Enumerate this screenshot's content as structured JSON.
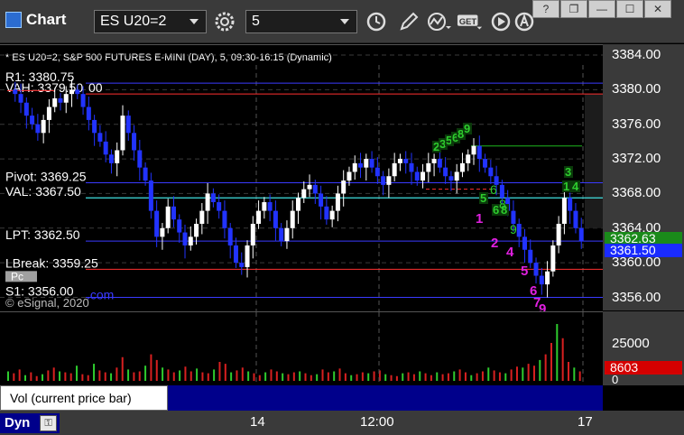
{
  "toolbar": {
    "title": "Chart",
    "symbol": "ES U20=2",
    "interval": "5",
    "get_label": "GET"
  },
  "window_buttons": [
    "?",
    "❐",
    "—",
    "☐",
    "✕"
  ],
  "chart": {
    "header": "* ES U20=2, S&P 500 FUTURES E-MINI (DAY), 5, 09:30-16:15 (Dynamic)",
    "watermark": "© eSignal, 2020",
    "levels": [
      {
        "label": "R1: 3380.75",
        "price": 3380.75,
        "color": "#3a3aff"
      },
      {
        "label": "VAH: 3379.50",
        "price": 3379.5,
        "color": "#ff3030"
      },
      {
        "label": "Pivot: 3369.25",
        "price": 3369.25,
        "color": "#3a3aff"
      },
      {
        "label": "VAL: 3367.50",
        "price": 3367.5,
        "color": "#40e0e0"
      },
      {
        "label": "LPT: 3362.50",
        "price": 3362.5,
        "color": "#3a3aff"
      },
      {
        "label": "LBreak: 3359.25",
        "price": 3359.25,
        "color": "#ff3030"
      },
      {
        "label": "S1: 3356.00",
        "price": 3356.0,
        "color": "#3a3aff"
      }
    ],
    "extra_labels": {
      "vah_overlap": "00",
      "pc_tag": "Pc",
      "com_tag": ".com"
    },
    "seq_numbers_magenta": [
      "1",
      "2",
      "4",
      "5",
      "6",
      "7",
      "9"
    ],
    "seq_numbers_green": [
      "2",
      "3",
      "5",
      "6",
      "8",
      "9",
      "3",
      "1",
      "4",
      "5",
      "6",
      "8"
    ]
  },
  "price_axis": {
    "ticks": [
      "3384.00",
      "3380.00",
      "3376.00",
      "3372.00",
      "3368.00",
      "3364.00",
      "3360.00",
      "3356.00"
    ],
    "badge_green": "3362.63",
    "badge_blue": "3361.50"
  },
  "volume": {
    "legend": "Vol (current price bar)",
    "close_glyph": "×",
    "ticks": [
      "25000",
      "0"
    ],
    "badge_red": "8603"
  },
  "time_axis": {
    "ticks": [
      "14",
      "12:00",
      "17"
    ],
    "dyn_label": "Dyn"
  },
  "colors": {
    "up_candle": "#ffffff",
    "down_candle": "#2233ff",
    "badge_green": "#1a8a1a",
    "badge_blue": "#1a2bff",
    "badge_red": "#d40000"
  }
}
